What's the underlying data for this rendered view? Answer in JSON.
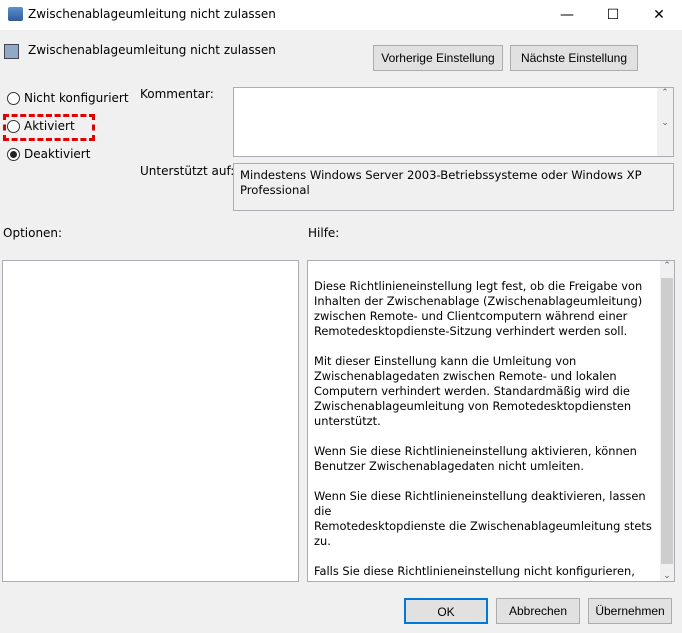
{
  "window": {
    "title": "Zwischenablageumleitung nicht zulassen",
    "minimize": "—",
    "maximize": "☐",
    "close": "✕"
  },
  "header": {
    "title": "Zwischenablageumleitung nicht zulassen",
    "prev_button": "Vorherige Einstellung",
    "next_button": "Nächste Einstellung"
  },
  "state": {
    "options": [
      {
        "label": "Nicht konfiguriert",
        "selected": false
      },
      {
        "label": "Aktiviert",
        "selected": false
      },
      {
        "label": "Deaktiviert",
        "selected": true
      }
    ]
  },
  "comment": {
    "label": "Kommentar:",
    "value": ""
  },
  "supported": {
    "label": "Unterstützt auf:",
    "value": "Mindestens Windows Server 2003-Betriebssysteme oder Windows XP Professional"
  },
  "options_label": "Optionen:",
  "help_label": "Hilfe:",
  "help_text": "Diese Richtlinieneinstellung legt fest, ob die Freigabe von\nInhalten der Zwischenablage (Zwischenablageumleitung)\nzwischen Remote- und Clientcomputern während einer\nRemotedesktopdienste-Sitzung verhindert werden soll.\n\nMit dieser Einstellung kann die Umleitung von\nZwischenablagedaten zwischen Remote- und lokalen\nComputern verhindert werden. Standardmäßig wird die\nZwischenablageumleitung von Remotedesktopdiensten\nunterstützt.\n\nWenn Sie diese Richtlinieneinstellung aktivieren, können\nBenutzer Zwischenablagedaten nicht umleiten.\n\nWenn Sie diese Richtlinieneinstellung deaktivieren, lassen die\nRemotedesktopdienste die Zwischenablageumleitung stets zu.\n\nFalls Sie diese Richtlinieneinstellung nicht konfigurieren, wird die\nZwischenablageumleitung auf Gruppenrichtlinienebene nicht\nfestgelegt.",
  "footer": {
    "ok": "OK",
    "cancel": "Abbrechen",
    "apply": "Übernehmen"
  },
  "colors": {
    "highlight": "#e00000",
    "ok_border": "#0078d7"
  }
}
